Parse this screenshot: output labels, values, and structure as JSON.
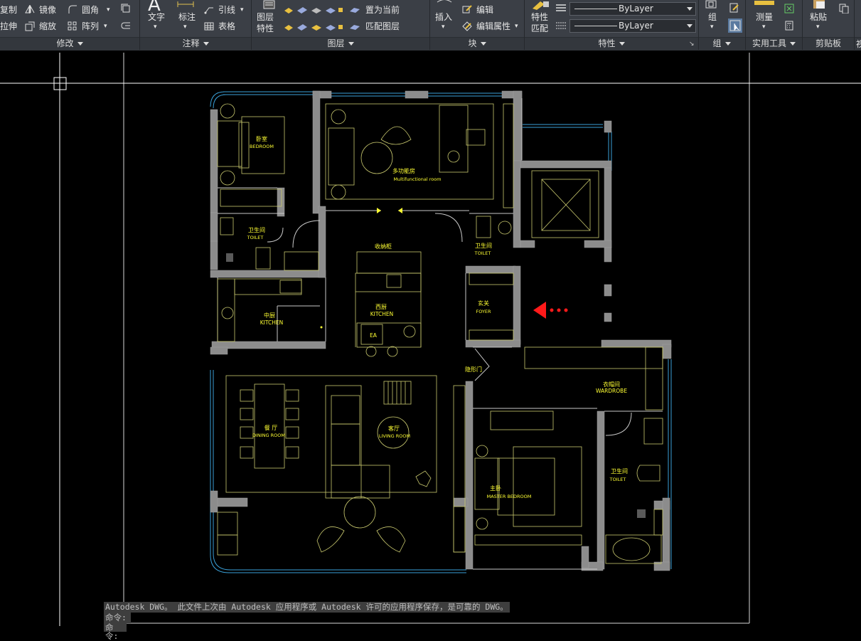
{
  "ribbon": {
    "modify": {
      "copy": "复制",
      "stretch": "拉伸",
      "mirror": "镜像",
      "scale": "缩放",
      "fillet": "圆角",
      "array": "阵列",
      "title": "修改"
    },
    "annotation": {
      "text": "文字",
      "dimension": "标注",
      "leader": "引线",
      "table": "表格",
      "title": "注释"
    },
    "layers": {
      "layer_props_1": "图层",
      "layer_props_2": "特性",
      "set_current": "置为当前",
      "match_layer": "匹配图层",
      "title": "图层"
    },
    "block": {
      "insert": "插入",
      "edit": "编辑",
      "edit_attr": "编辑属性",
      "title": "块"
    },
    "properties": {
      "match_1": "特性",
      "match_2": "匹配",
      "linetype": "ByLayer",
      "lineweight": "ByLayer",
      "title": "特性"
    },
    "groups": {
      "group": "组",
      "title": "组"
    },
    "utilities": {
      "measure": "测量",
      "title": "实用工具"
    },
    "clipboard": {
      "paste": "粘贴",
      "title": "剪贴板"
    }
  },
  "plan_labels": {
    "bedroom_cn": "卧室",
    "bedroom_en": "BEDROOM",
    "multi_cn": "多功能房",
    "multi_en": "Multifunctional room",
    "toilet1_cn": "卫生间",
    "toilet1_en": "TOILET",
    "storage_cn": "收纳柜",
    "toilet2_cn": "卫生间",
    "toilet2_en": "TOILET",
    "kitchen1_cn": "中厨",
    "kitchen1_en": "KITCHEN",
    "kitchen2_cn": "西厨",
    "kitchen2_en": "KITCHEN",
    "ea": "EA",
    "foyer_cn": "玄关",
    "foyer_en": "FOYER",
    "hidden_door": "隐形门",
    "wardrobe_cn": "衣帽间",
    "wardrobe_en": "WARDROBE",
    "dining_cn": "餐 厅",
    "dining_en": "DINING ROOM",
    "living_cn": "客厅",
    "living_en": "LIVING ROOM",
    "master_cn": "主卧",
    "master_en": "MASTER BEDROOM",
    "toilet3_cn": "卫生间",
    "toilet3_en": "TOILET"
  },
  "command": {
    "history": "Autodesk DWG。  此文件上次由 Autodesk 应用程序或 Autodesk 许可的应用程序保存，是可靠的 DWG。",
    "prompt": "命令:",
    "prompt2": "命令:"
  },
  "colors": {
    "ribbon_bg": "#3b3f46",
    "canvas_bg": "#000000",
    "wall": "#8c8c8c",
    "furniture": "#c8c86e",
    "label": "#ffff33",
    "window": "#3aa0d8",
    "marker": "#ff1a1a"
  }
}
